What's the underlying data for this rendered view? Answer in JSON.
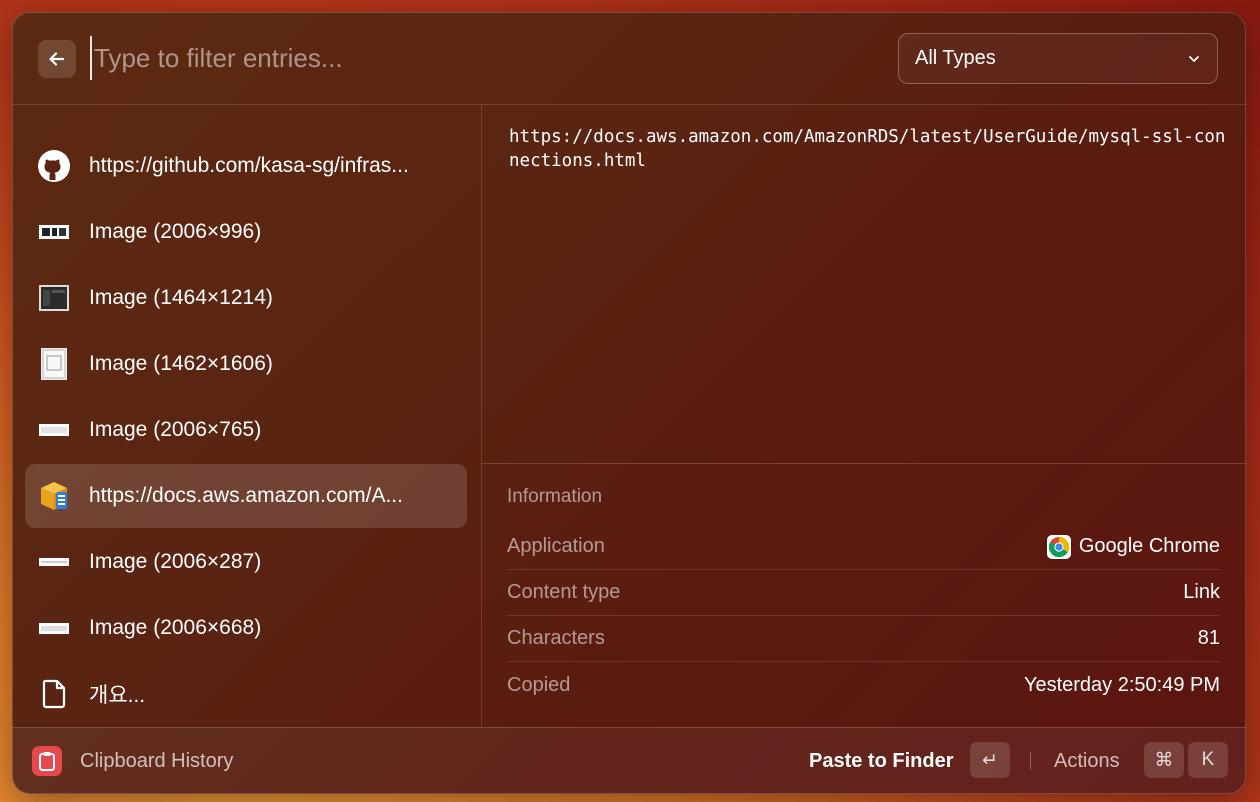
{
  "search": {
    "placeholder": "Type to filter entries...",
    "value": ""
  },
  "type_filter": {
    "selected": "All Types"
  },
  "entries": [
    {
      "label": "https://github.com/kasa-sg/infras...",
      "icon": "github-icon"
    },
    {
      "label": "Image (2006×996)",
      "icon": "image-thumbnail-icon"
    },
    {
      "label": "Image (1464×1214)",
      "icon": "image-thumbnail-icon"
    },
    {
      "label": "Image (1462×1606)",
      "icon": "image-thumbnail-icon"
    },
    {
      "label": "Image (2006×765)",
      "icon": "image-thumbnail-icon"
    },
    {
      "label": "https://docs.aws.amazon.com/A...",
      "icon": "aws-docs-icon",
      "selected": true
    },
    {
      "label": "Image (2006×287)",
      "icon": "image-thumbnail-icon"
    },
    {
      "label": "Image (2006×668)",
      "icon": "image-thumbnail-icon"
    },
    {
      "label": "개요...",
      "icon": "document-icon"
    }
  ],
  "detail": {
    "content": "https://docs.aws.amazon.com/AmazonRDS/latest/UserGuide/mysql-ssl-connections.html",
    "info_title": "Information",
    "rows": [
      {
        "key": "Application",
        "value": "Google Chrome",
        "icon": "chrome-icon"
      },
      {
        "key": "Content type",
        "value": "Link"
      },
      {
        "key": "Characters",
        "value": "81"
      },
      {
        "key": "Copied",
        "value": "Yesterday 2:50:49 PM"
      }
    ]
  },
  "footer": {
    "app_name": "Clipboard History",
    "primary_action": "Paste to Finder",
    "primary_key": "↵",
    "actions_label": "Actions",
    "actions_keys": [
      "⌘",
      "K"
    ]
  },
  "colors": {
    "accent": "#e5484d"
  }
}
